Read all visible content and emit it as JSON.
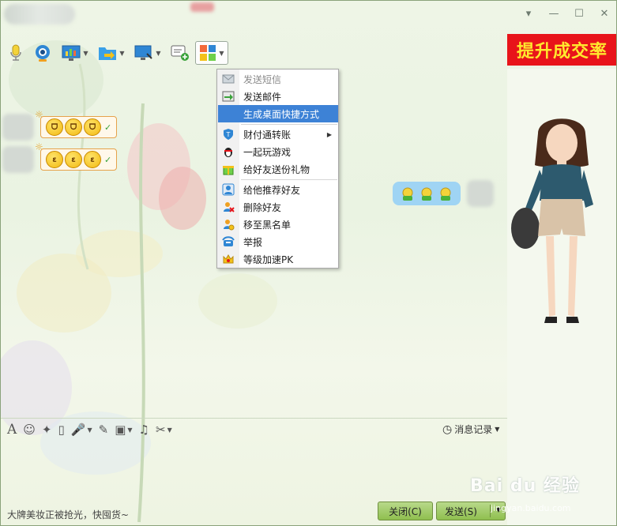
{
  "ad_banner": {
    "text": "提升成交率"
  },
  "window_controls": {
    "dropdown": "▾",
    "minimize": "—",
    "maximize": "☐",
    "close": "✕"
  },
  "menu": {
    "items": [
      {
        "label": "发送短信",
        "disabled": true
      },
      {
        "label": "发送邮件"
      },
      {
        "label": "生成桌面快捷方式",
        "selected": true
      },
      {
        "label": "财付通转账",
        "submenu": true
      },
      {
        "label": "一起玩游戏"
      },
      {
        "label": "给好友送份礼物"
      },
      {
        "label": "给他推荐好友"
      },
      {
        "label": "删除好友"
      },
      {
        "label": "移至黑名单"
      },
      {
        "label": "举报"
      },
      {
        "label": "等级加速PK"
      }
    ]
  },
  "input": {
    "history_label": "消息记录"
  },
  "footer": {
    "tip": "大牌美妆正被抢光，快囤货~",
    "close_label": "关闭(C)",
    "send_label": "发送(S)"
  },
  "watermark": {
    "main": "Bai du 经验",
    "sub": "jingyan.baidu.com"
  },
  "colors": {
    "accent_green": "#8fbf4f",
    "menu_selected": "#3d82d6",
    "ad_bg": "#e8141a",
    "ad_text": "#ffe92e",
    "bubble_right": "#9fd4f4"
  }
}
